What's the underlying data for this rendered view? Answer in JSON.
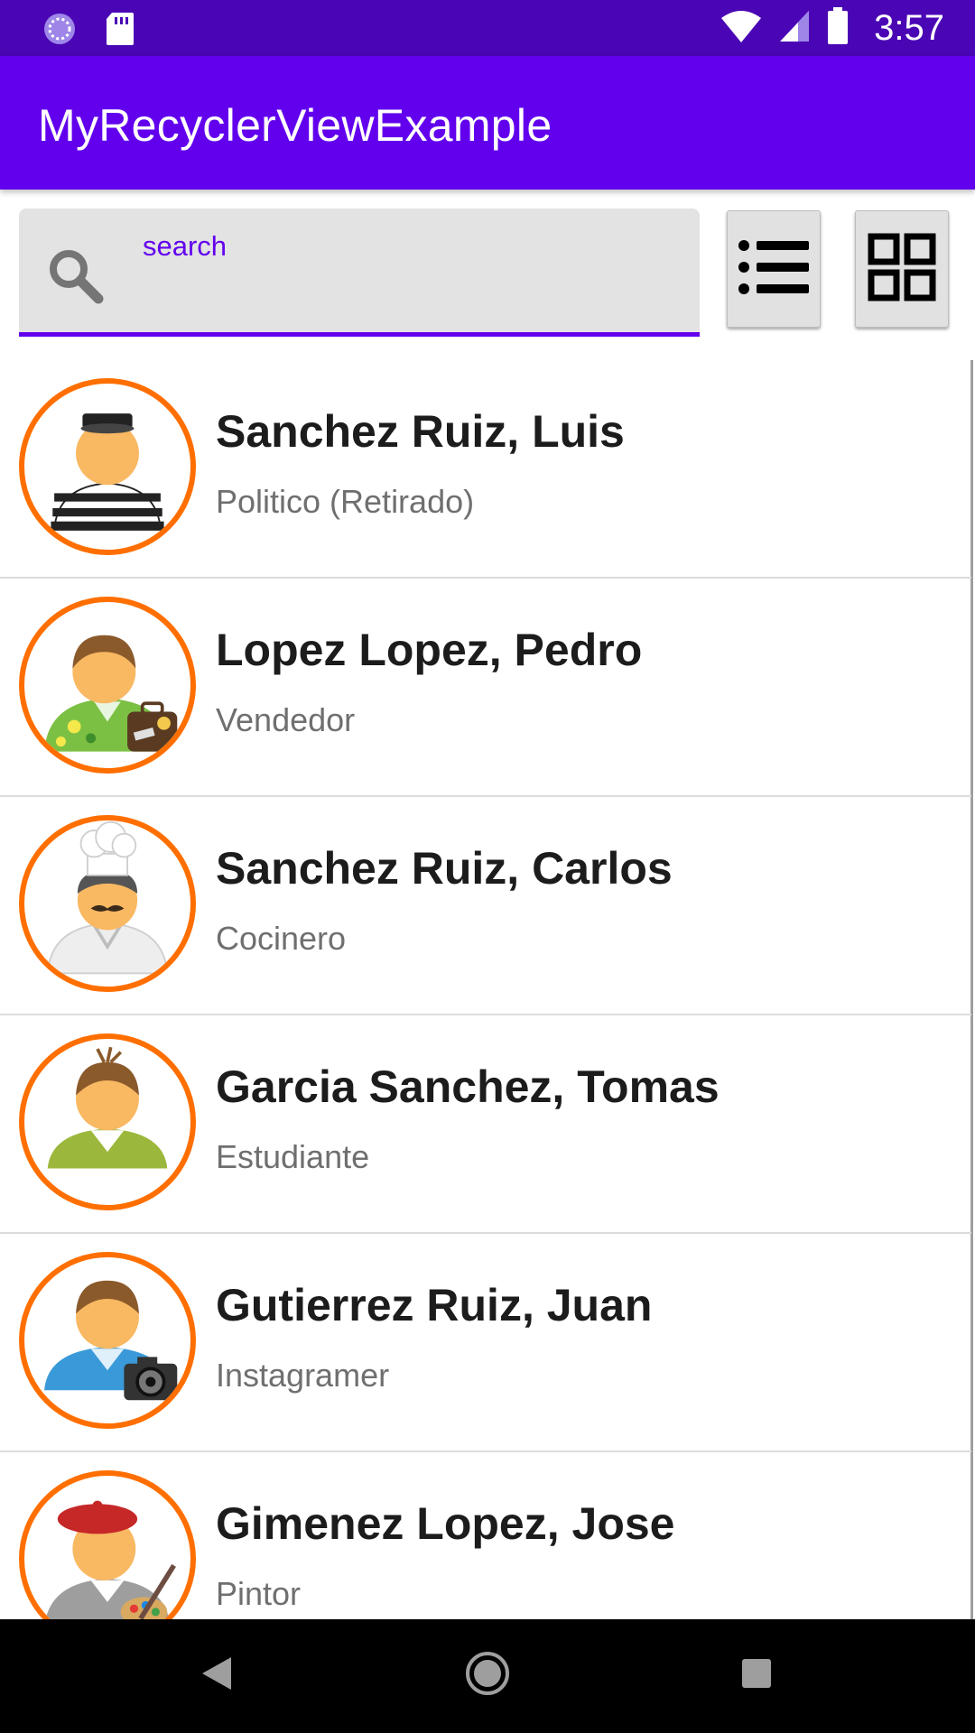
{
  "status_bar": {
    "time": "3:57"
  },
  "app_bar": {
    "title": "MyRecyclerViewExample"
  },
  "search": {
    "placeholder": "search"
  },
  "colors": {
    "primary": "#6200ee",
    "primary_dark": "#4a06b5",
    "avatar_ring": "#ff6f00",
    "name_text": "#1c1c1c",
    "job_text": "#6f6f6f"
  },
  "people": [
    {
      "name": "Sanchez Ruiz, Luis",
      "job": "Politico (Retirado)",
      "avatar": "prisoner-avatar-icon"
    },
    {
      "name": "Lopez Lopez, Pedro",
      "job": "Vendedor",
      "avatar": "salesman-avatar-icon"
    },
    {
      "name": "Sanchez Ruiz, Carlos",
      "job": "Cocinero",
      "avatar": "chef-avatar-icon"
    },
    {
      "name": "Garcia Sanchez, Tomas",
      "job": "Estudiante",
      "avatar": "student-avatar-icon"
    },
    {
      "name": "Gutierrez Ruiz, Juan",
      "job": "Instagramer",
      "avatar": "photographer-avatar-icon"
    },
    {
      "name": "Gimenez Lopez, Jose",
      "job": "Pintor",
      "avatar": "painter-avatar-icon"
    }
  ]
}
